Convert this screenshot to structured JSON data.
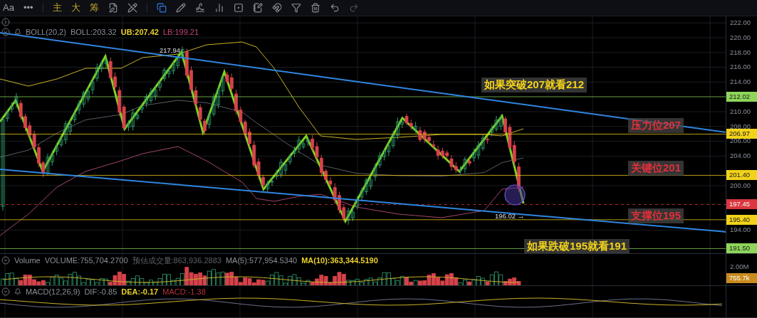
{
  "toolbar": {
    "font_button": "Aa",
    "more_button": "•••",
    "chart_modes": [
      "主",
      "大",
      "筹"
    ]
  },
  "main_pane": {
    "legend": {
      "name": "BOLL(20,2)",
      "values": [
        {
          "text": "BOLL:203.32",
          "color": "#8a8f99",
          "emphasized": false
        },
        {
          "text": "UB:207.42",
          "color": "#e8cf2a",
          "emphasized": true
        },
        {
          "text": "LB:199.21",
          "color": "#c2457b",
          "emphasized": false
        }
      ]
    },
    "price_axis": [
      "222.00",
      "220.00",
      "218.00",
      "216.00",
      "214.00",
      "210.00",
      "208.00",
      "206.00",
      "204.00",
      "200.00",
      "194.00"
    ],
    "price_tags": [
      {
        "text": "212.02",
        "color": "#8ed65a"
      },
      {
        "text": "206.97",
        "color": "#f2d21b"
      },
      {
        "text": "201.40",
        "color": "#f2d21b"
      },
      {
        "text": "197.45",
        "color": "#d9363e"
      },
      {
        "text": "195.40",
        "color": "#f2d21b"
      },
      {
        "text": "191.50",
        "color": "#8ed65a"
      }
    ],
    "marks": [
      "217.94",
      "196.02 →"
    ],
    "annotations": [
      {
        "text": "如果突破207就看212",
        "kind": "scenario"
      },
      {
        "text": "压力位207",
        "kind": "level"
      },
      {
        "text": "关键位201",
        "kind": "level"
      },
      {
        "text": "支撑位195",
        "kind": "level"
      },
      {
        "text": "如果跌破195就看191",
        "kind": "scenario"
      }
    ]
  },
  "volume_pane": {
    "legend": {
      "name": "Volume",
      "values": [
        {
          "text": "VOLUME:755,704.2700",
          "color": "#8a8f99",
          "emphasized": false
        },
        {
          "text": "预估成交量:863,936.2883",
          "color": "#5c6069",
          "emphasized": false
        },
        {
          "text": "MA(5):577,954.5340",
          "color": "#8a8f99",
          "emphasized": false
        },
        {
          "text": "MA(10):363,344.5190",
          "color": "#e8cf2a",
          "emphasized": true
        }
      ]
    },
    "axis": [
      "2.00M"
    ],
    "tag": {
      "text": "755.7k",
      "color": "#c98a1e"
    }
  },
  "macd_pane": {
    "legend": {
      "name": "MACD(12,26,9)",
      "values": [
        {
          "text": "DIF:-0.85",
          "color": "#8a8f99",
          "emphasized": false
        },
        {
          "text": "DEA:-0.17",
          "color": "#e8cf2a",
          "emphasized": true
        },
        {
          "text": "MACD:-1.38",
          "color": "#b2333b",
          "emphasized": false
        }
      ]
    }
  }
}
